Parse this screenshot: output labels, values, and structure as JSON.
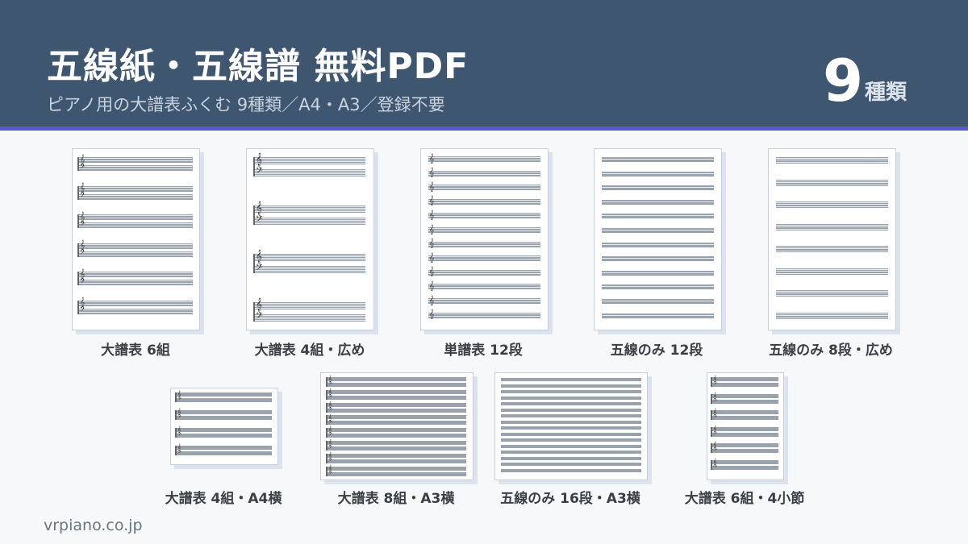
{
  "header": {
    "title": "五線紙・五線譜 無料PDF",
    "subtitle": "ピアノ用の大譜表ふくむ 9種類／A4・A3／登録不要",
    "count": "9",
    "count_unit": "種類"
  },
  "templates": [
    {
      "caption": "大譜表 6組"
    },
    {
      "caption": "大譜表 4組・広め"
    },
    {
      "caption": "単譜表 12段"
    },
    {
      "caption": "五線のみ 12段"
    },
    {
      "caption": "五線のみ 8段・広め"
    },
    {
      "caption": "大譜表 4組・A4横"
    },
    {
      "caption": "大譜表 8組・A3横"
    },
    {
      "caption": "五線のみ 16段・A3横"
    },
    {
      "caption": "大譜表 6組・4小節"
    }
  ],
  "footer": {
    "site": "vrpiano.co.jp"
  },
  "colors": {
    "header_bg": "#3f5670",
    "accent_line": "#5a56d8",
    "page_bg": "#f7f8fa"
  },
  "icons": {
    "treble_clef": "treble-clef-icon",
    "bass_clef": "bass-clef-icon"
  }
}
